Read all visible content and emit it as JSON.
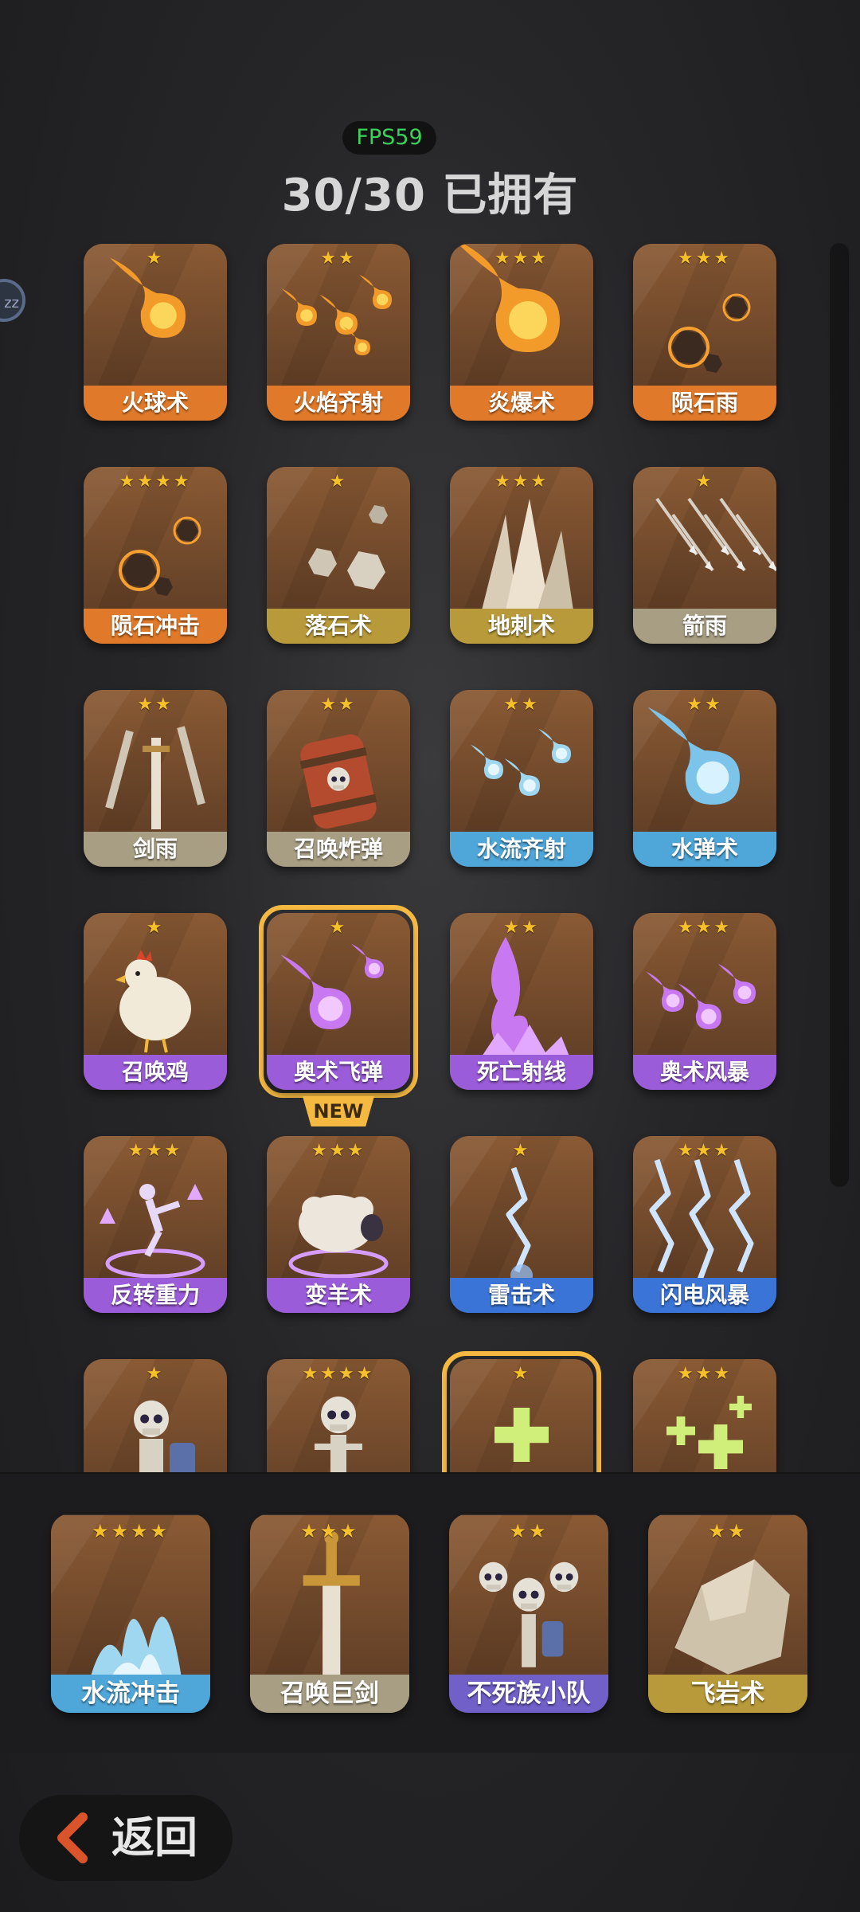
{
  "hud": {
    "fps": "FPS59"
  },
  "header": {
    "title": "30/30 已拥有",
    "side_badge": "zz"
  },
  "cards": [
    {
      "label": "火球术",
      "stars": 1,
      "theme": "fire",
      "art": "fireball"
    },
    {
      "label": "火焰齐射",
      "stars": 2,
      "theme": "fire",
      "art": "fire-volley"
    },
    {
      "label": "炎爆术",
      "stars": 3,
      "theme": "fire",
      "art": "big-fireball"
    },
    {
      "label": "陨石雨",
      "stars": 3,
      "theme": "fire",
      "art": "meteor-rain"
    },
    {
      "label": "陨石冲击",
      "stars": 4,
      "theme": "fire",
      "art": "meteor-impact"
    },
    {
      "label": "落石术",
      "stars": 1,
      "theme": "earth",
      "art": "falling-rocks"
    },
    {
      "label": "地刺术",
      "stars": 3,
      "theme": "earth",
      "art": "spikes"
    },
    {
      "label": "箭雨",
      "stars": 1,
      "theme": "stone",
      "art": "arrow-rain"
    },
    {
      "label": "剑雨",
      "stars": 2,
      "theme": "stone",
      "art": "sword-rain"
    },
    {
      "label": "召唤炸弹",
      "stars": 2,
      "theme": "stone",
      "art": "bomb-barrel"
    },
    {
      "label": "水流齐射",
      "stars": 2,
      "theme": "water",
      "art": "water-volley"
    },
    {
      "label": "水弹术",
      "stars": 2,
      "theme": "water",
      "art": "water-ball"
    },
    {
      "label": "召唤鸡",
      "stars": 1,
      "theme": "arcane",
      "art": "chicken"
    },
    {
      "label": "奥术飞弹",
      "stars": 1,
      "theme": "arcane",
      "art": "arcane-missile",
      "selected": true,
      "new_tag": "NEW"
    },
    {
      "label": "死亡射线",
      "stars": 2,
      "theme": "arcane",
      "art": "death-ray"
    },
    {
      "label": "奥术风暴",
      "stars": 3,
      "theme": "arcane",
      "art": "arcane-storm"
    },
    {
      "label": "反转重力",
      "stars": 3,
      "theme": "arcane",
      "art": "gravity"
    },
    {
      "label": "变羊术",
      "stars": 3,
      "theme": "arcane",
      "art": "sheep"
    },
    {
      "label": "雷击术",
      "stars": 1,
      "theme": "lightning",
      "art": "lightning"
    },
    {
      "label": "闪电风暴",
      "stars": 3,
      "theme": "lightning",
      "art": "lightning-storm"
    },
    {
      "label": "",
      "stars": 1,
      "theme": "undead",
      "art": "skeleton-shield"
    },
    {
      "label": "",
      "stars": 4,
      "theme": "undead",
      "art": "skeleton"
    },
    {
      "label": "",
      "stars": 1,
      "theme": "heal",
      "art": "heal-cross",
      "selected": true
    },
    {
      "label": "",
      "stars": 3,
      "theme": "heal",
      "art": "heal-crosses"
    }
  ],
  "bottom_cards": [
    {
      "label": "水流冲击",
      "stars": 4,
      "theme": "water",
      "art": "water-burst"
    },
    {
      "label": "召唤巨剑",
      "stars": 3,
      "theme": "stone",
      "art": "great-sword"
    },
    {
      "label": "不死族小队",
      "stars": 2,
      "theme": "undead",
      "art": "skeleton-squad"
    },
    {
      "label": "飞岩术",
      "stars": 2,
      "theme": "earth",
      "art": "flying-rock"
    }
  ],
  "themes": {
    "fire": {
      "bg1": "#8a5a34",
      "bg2": "#5a3a24",
      "band": "#e07a2a"
    },
    "earth": {
      "bg1": "#7a6448",
      "bg2": "#4e4030",
      "band": "#b89a3a"
    },
    "stone": {
      "bg1": "#706a60",
      "bg2": "#48443e",
      "band": "#a79e84"
    },
    "water": {
      "bg1": "#3a78b8",
      "bg2": "#23507e",
      "band": "#4fa6d8"
    },
    "arcane": {
      "bg1": "#8a5cc4",
      "bg2": "#5c3a8e",
      "band": "#9a5cd8"
    },
    "lightning": {
      "bg1": "#2c3a66",
      "bg2": "#1c2444",
      "band": "#3a74d6"
    },
    "undead": {
      "bg1": "#5a4cab",
      "bg2": "#332a6e",
      "band": "#7060c8"
    },
    "heal": {
      "bg1": "#7ab640",
      "bg2": "#4a7a22",
      "band": "#8ac840"
    }
  },
  "footer": {
    "back_label": "返回"
  },
  "colors": {
    "star": "#f5c02a",
    "selected_ring": "#f5b942",
    "fps_text": "#3bd15a",
    "back_arrow": "#d9542b"
  }
}
